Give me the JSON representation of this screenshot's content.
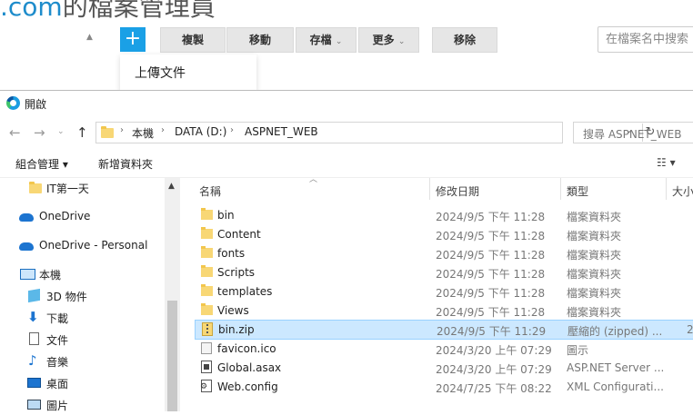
{
  "background_page": {
    "title_partial": ".com",
    "title_rest": "的檔案管理員",
    "add_button": "+",
    "buttons": [
      {
        "label": "複製",
        "caret": ""
      },
      {
        "label": "移動",
        "caret": ""
      },
      {
        "label": "存檔",
        "caret": "⌄"
      },
      {
        "label": "更多",
        "caret": "⌄"
      },
      {
        "label": "移除",
        "caret": ""
      }
    ],
    "search_placeholder": "在檔案名中搜索",
    "dropdown_item": "上傳文件"
  },
  "dialog": {
    "title": "開啟",
    "breadcrumb": [
      "本機",
      "DATA (D:)",
      "ASPNET_WEB"
    ],
    "search_placeholder": "搜尋 ASPNET_WEB",
    "toolbar": {
      "organize": "組合管理 ▾",
      "new_folder": "新增資料夾",
      "view": "☷ ▾"
    },
    "nav": [
      {
        "label": "IT第一天",
        "icon": "folder-icon"
      },
      {
        "label": "OneDrive",
        "icon": "onedrive-icon"
      },
      {
        "label": "OneDrive - Personal",
        "icon": "onedrive-icon"
      },
      {
        "label": "本機",
        "icon": "computer-icon"
      },
      {
        "label": "3D 物件",
        "icon": "3d-objects-icon"
      },
      {
        "label": "下載",
        "icon": "download-icon"
      },
      {
        "label": "文件",
        "icon": "document-icon"
      },
      {
        "label": "音樂",
        "icon": "music-icon"
      },
      {
        "label": "桌面",
        "icon": "desktop-icon"
      },
      {
        "label": "圖片",
        "icon": "pictures-icon"
      }
    ],
    "columns": {
      "name": "名稱",
      "date": "修改日期",
      "type": "類型",
      "size": "大小"
    },
    "files": [
      {
        "name": "bin",
        "date": "2024/9/5 下午 11:28",
        "type": "檔案資料夾",
        "size": "",
        "icon": "folder-icon"
      },
      {
        "name": "Content",
        "date": "2024/9/5 下午 11:28",
        "type": "檔案資料夾",
        "size": "",
        "icon": "folder-icon"
      },
      {
        "name": "fonts",
        "date": "2024/9/5 下午 11:28",
        "type": "檔案資料夾",
        "size": "",
        "icon": "folder-icon"
      },
      {
        "name": "Scripts",
        "date": "2024/9/5 下午 11:28",
        "type": "檔案資料夾",
        "size": "",
        "icon": "folder-icon"
      },
      {
        "name": "templates",
        "date": "2024/9/5 下午 11:28",
        "type": "檔案資料夾",
        "size": "",
        "icon": "folder-icon"
      },
      {
        "name": "Views",
        "date": "2024/9/5 下午 11:28",
        "type": "檔案資料夾",
        "size": "",
        "icon": "folder-icon"
      },
      {
        "name": "bin.zip",
        "date": "2024/9/5 下午 11:29",
        "type": "壓縮的 (zipped) ...",
        "size": "2",
        "icon": "zip-icon",
        "selected": true
      },
      {
        "name": "favicon.ico",
        "date": "2024/3/20 上午 07:29",
        "type": "圖示",
        "size": "",
        "icon": "ico-file-icon"
      },
      {
        "name": "Global.asax",
        "date": "2024/3/20 上午 07:29",
        "type": "ASP.NET Server ...",
        "size": "",
        "icon": "asax-file-icon"
      },
      {
        "name": "Web.config",
        "date": "2024/7/25 下午 08:22",
        "type": "XML Configurati...",
        "size": "",
        "icon": "config-file-icon"
      }
    ]
  }
}
